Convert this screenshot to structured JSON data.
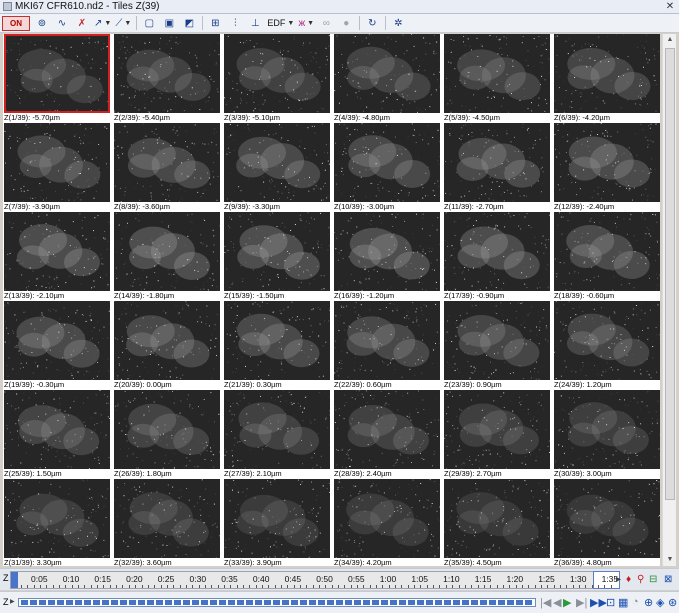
{
  "window": {
    "title": "MKI67 CFR610.nd2 - Tiles   Z(39)"
  },
  "toolbar": {
    "on_label": "ON",
    "edf_label": "EDF",
    "icons": [
      "on-toggle-icon",
      "roi-icon",
      "profile-icon",
      "delete-icon",
      "export-icon",
      "lut-icon",
      "view-single-icon",
      "view-frames-icon",
      "view-3d-icon",
      "tiles-icon",
      "sort-icon",
      "filter-icon",
      "edf-icon",
      "butterfly-icon",
      "binoculars-icon",
      "reset-icon",
      "refresh-icon",
      "settings-icon"
    ]
  },
  "tiles": [
    {
      "label": "Z(1/39): -5.70µm",
      "selected": true
    },
    {
      "label": "Z(2/39): -5.40µm"
    },
    {
      "label": "Z(3/39): -5.10µm"
    },
    {
      "label": "Z(4/39): -4.80µm"
    },
    {
      "label": "Z(5/39): -4.50µm"
    },
    {
      "label": "Z(6/39): -4.20µm"
    },
    {
      "label": "Z(7/39): -3.90µm"
    },
    {
      "label": "Z(8/39): -3.60µm"
    },
    {
      "label": "Z(9/39): -3.30µm"
    },
    {
      "label": "Z(10/39): -3.00µm"
    },
    {
      "label": "Z(11/39): -2.70µm"
    },
    {
      "label": "Z(12/39): -2.40µm"
    },
    {
      "label": "Z(13/39): -2.10µm"
    },
    {
      "label": "Z(14/39): -1.80µm"
    },
    {
      "label": "Z(15/39): -1.50µm"
    },
    {
      "label": "Z(16/39): -1.20µm"
    },
    {
      "label": "Z(17/39): -0.90µm"
    },
    {
      "label": "Z(18/39): -0.60µm"
    },
    {
      "label": "Z(19/39): -0.30µm"
    },
    {
      "label": "Z(20/39): 0.00µm"
    },
    {
      "label": "Z(21/39): 0.30µm"
    },
    {
      "label": "Z(22/39): 0.60µm"
    },
    {
      "label": "Z(23/39): 0.90µm"
    },
    {
      "label": "Z(24/39): 1.20µm"
    },
    {
      "label": "Z(25/39): 1.50µm"
    },
    {
      "label": "Z(26/39): 1.80µm"
    },
    {
      "label": "Z(27/39): 2.10µm"
    },
    {
      "label": "Z(28/39): 2.40µm"
    },
    {
      "label": "Z(29/39): 2.70µm"
    },
    {
      "label": "Z(30/39): 3.00µm"
    },
    {
      "label": "Z(31/39): 3.30µm"
    },
    {
      "label": "Z(32/39): 3.60µm"
    },
    {
      "label": "Z(33/39): 3.90µm"
    },
    {
      "label": "Z(34/39): 4.20µm"
    },
    {
      "label": "Z(35/39): 4.50µm"
    },
    {
      "label": "Z(36/39): 4.80µm"
    }
  ],
  "timeline": {
    "axis": "Z",
    "ticks": [
      "0:05",
      "0:10",
      "0:15",
      "0:20",
      "0:25",
      "0:30",
      "0:35",
      "0:40",
      "0:45",
      "0:50",
      "0:55",
      "1:00",
      "1:05",
      "1:10",
      "1:15",
      "1:20",
      "1:25",
      "1:30",
      "1:35"
    ]
  },
  "playbar": {
    "axis": "Z"
  },
  "colors": {
    "selection": "#d21f1f",
    "accent": "#4a74c9"
  }
}
